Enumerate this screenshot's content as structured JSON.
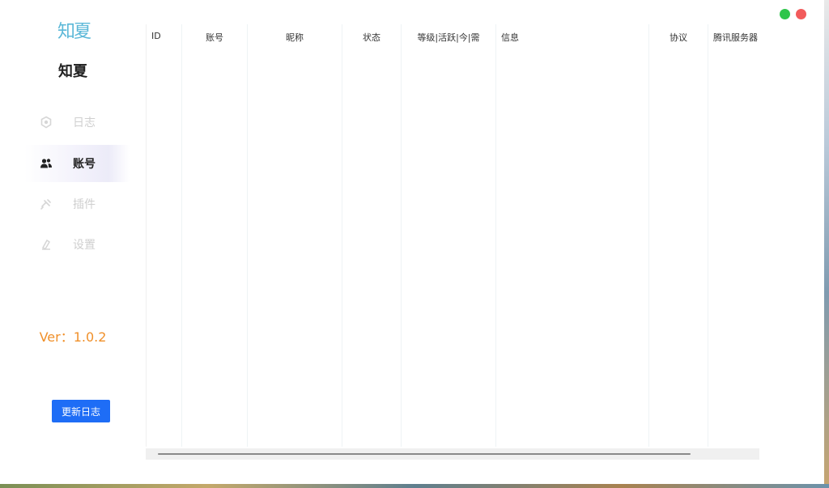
{
  "app": {
    "logo_text": "知夏",
    "name": "知夏",
    "version": "Ver：1.0.2",
    "changelog_label": "更新日志"
  },
  "sidebar": {
    "items": [
      {
        "label": "日志",
        "icon": "log-icon",
        "active": false
      },
      {
        "label": "账号",
        "icon": "users-icon",
        "active": true
      },
      {
        "label": "插件",
        "icon": "plugin-icon",
        "active": false
      },
      {
        "label": "设置",
        "icon": "settings-icon",
        "active": false
      }
    ]
  },
  "table": {
    "columns": [
      "ID",
      "账号",
      "昵称",
      "状态",
      "等级|活跃|今|需",
      "信息",
      "协议",
      "腾讯服务器"
    ],
    "rows": []
  },
  "colors": {
    "accent": "#1e6df6",
    "version": "#f0902a",
    "logo": "#5cb8d8",
    "window_max": "#2ec54a",
    "window_close": "#f25b5b"
  }
}
